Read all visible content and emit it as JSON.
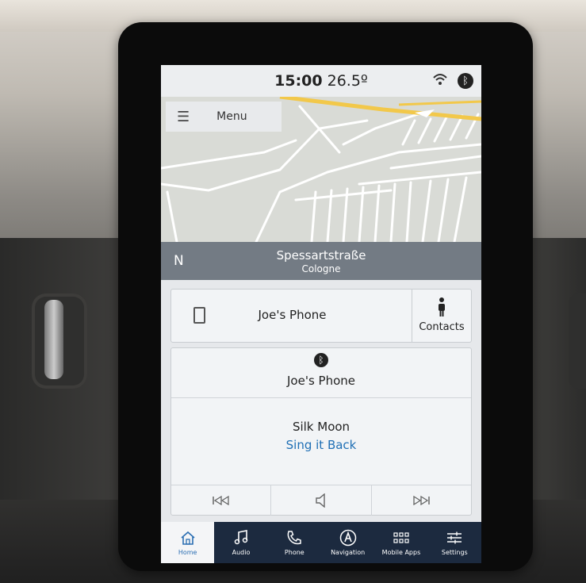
{
  "status": {
    "time": "15:00",
    "temperature": "26.5º",
    "icons": [
      "wifi-icon",
      "bluetooth-icon"
    ]
  },
  "map": {
    "menu_label": "Menu",
    "compass": "N",
    "street": "Spessartstraße",
    "city": "Cologne"
  },
  "phone": {
    "name": "Joe's Phone",
    "contacts_label": "Contacts"
  },
  "audio": {
    "source": "Joe's Phone",
    "song": "Silk Moon",
    "artist": "Sing it Back",
    "controls": [
      "previous-icon",
      "volume-icon",
      "next-icon"
    ]
  },
  "tabs": [
    {
      "label": "Home",
      "icon": "home-icon",
      "active": true
    },
    {
      "label": "Audio",
      "icon": "music-note-icon",
      "active": false
    },
    {
      "label": "Phone",
      "icon": "phone-handset-icon",
      "active": false
    },
    {
      "label": "Navigation",
      "icon": "navigation-icon",
      "active": false
    },
    {
      "label": "Mobile Apps",
      "icon": "apps-grid-icon",
      "active": false
    },
    {
      "label": "Settings",
      "icon": "sliders-icon",
      "active": false
    }
  ],
  "colors": {
    "accent_blue": "#1f6fb5",
    "tab_bar": "#1c2a3f",
    "nav_bar": "#737b84",
    "map_road_highlight": "#f2c84a"
  }
}
